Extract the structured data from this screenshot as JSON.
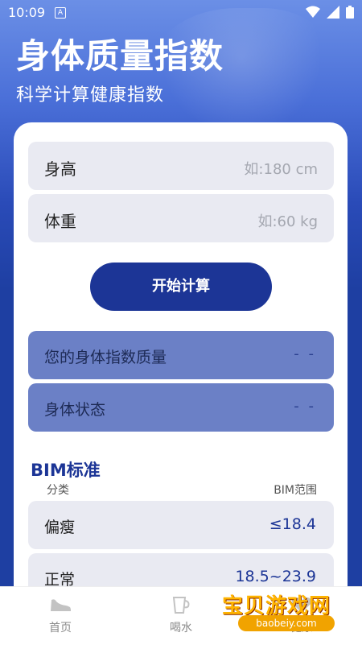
{
  "status_bar": {
    "time": "10:09",
    "notification_glyph": "A"
  },
  "header": {
    "title": "身体质量指数",
    "subtitle": "科学计算健康指数"
  },
  "form": {
    "height": {
      "label": "身高",
      "placeholder": "如:180  cm"
    },
    "weight": {
      "label": "体重",
      "placeholder": "如:60   kg"
    },
    "start_button": "开始计算"
  },
  "results": {
    "bmi": {
      "label": "您的身体指数质量",
      "value": "- -"
    },
    "status": {
      "label": "身体状态",
      "value": "- -"
    }
  },
  "standard": {
    "title": "BIM标准",
    "col_category": "分类",
    "col_range": "BIM范围",
    "rows": [
      {
        "name": "偏瘦",
        "range": "≤18.4"
      },
      {
        "name": "正常",
        "range": "18.5~23.9"
      }
    ]
  },
  "nav": {
    "items": [
      {
        "label": "首页",
        "icon": "shoe-icon"
      },
      {
        "label": "喝水",
        "icon": "cup-icon"
      },
      {
        "label": "健康",
        "icon": "heart-icon"
      }
    ]
  },
  "watermark": {
    "text": "宝贝游戏网",
    "url": "baobeiy.com"
  },
  "colors": {
    "primary": "#1c3596",
    "result_bg": "#6b80c6",
    "field_bg": "#e9eaf2"
  }
}
